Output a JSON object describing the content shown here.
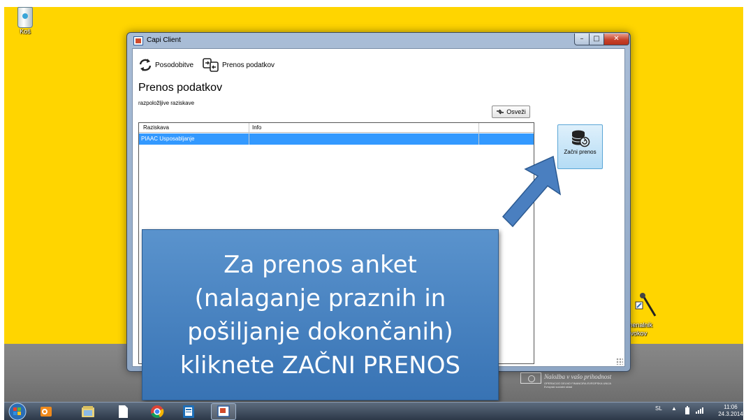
{
  "desktop": {
    "recycle_bin_label": "Koš",
    "mic_label_line1": "menalnik",
    "mic_label_line2": "zvokov",
    "logo": {
      "line1": "Naložba v vašo prihodnost",
      "line2": "OPERACIJO DELNO FINANCIRA EVROPSKA UNIJA",
      "line3": "Evropski socialni sklad"
    }
  },
  "window": {
    "title": "Capi Client",
    "toolbar": {
      "updates_label": "Posodobitve",
      "transfer_label": "Prenos podatkov"
    },
    "section_title": "Prenos podatkov",
    "list_caption": "razpoložljive raziskave",
    "refresh_label": "Osveži",
    "table": {
      "columns": [
        "Raziskava",
        "Info"
      ],
      "rows": [
        {
          "raziskava": "PIAAC Usposabljanje",
          "info": ""
        }
      ]
    },
    "start_transfer_label": "Začni prenos"
  },
  "callout": {
    "lines": [
      "Za prenos anket",
      "(nalaganje praznih in",
      "pošiljanje dokončanih)",
      "kliknete ZAČNI PRENOS"
    ]
  },
  "taskbar": {
    "apps": [
      "start-orb",
      "outlook",
      "file-explorer",
      "document",
      "chrome",
      "publisher",
      "capi-client"
    ],
    "language": "SL",
    "time": "11:06",
    "date": "24.3.2014"
  },
  "colors": {
    "desktop_yellow": "#ffd500",
    "selection_blue": "#3399ff",
    "callout_blue": "#4a86c5",
    "start_button_bg": "#c8e6f8"
  }
}
